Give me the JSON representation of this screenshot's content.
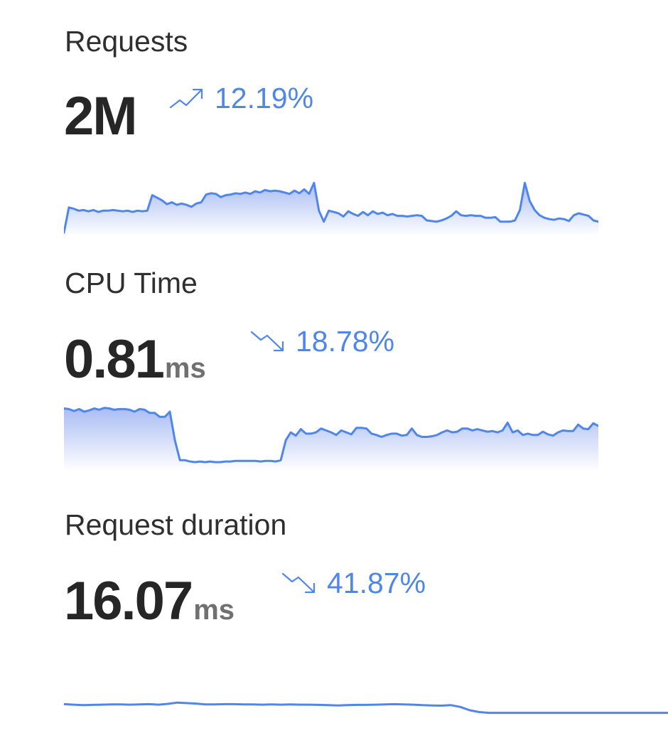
{
  "colors": {
    "accent": "#4f86ea",
    "fill_top": "#a9bcf3",
    "fill_bottom": "#ffffff",
    "title": "#2f2f2f",
    "value": "#262626",
    "unit": "#707070"
  },
  "metrics": [
    {
      "title": "Requests",
      "value": "2M",
      "unit": "",
      "change": "12.19%",
      "trend_icon": "trend-up-icon",
      "trend": "up",
      "sparkline": {
        "fill": true,
        "ylim": [
          0,
          100
        ],
        "values": [
          3,
          42,
          40,
          37,
          38,
          36,
          38,
          35,
          37,
          37,
          38,
          37,
          36,
          37,
          35,
          37,
          36,
          37,
          61,
          57,
          53,
          47,
          50,
          46,
          48,
          46,
          43,
          48,
          50,
          62,
          64,
          63,
          58,
          61,
          62,
          64,
          63,
          65,
          63,
          67,
          65,
          69,
          67,
          68,
          67,
          65,
          63,
          68,
          64,
          70,
          63,
          80,
          37,
          20,
          37,
          35,
          33,
          28,
          36,
          32,
          29,
          35,
          30,
          36,
          32,
          34,
          30,
          32,
          29,
          29,
          28,
          29,
          30,
          29,
          22,
          21,
          20,
          22,
          25,
          29,
          36,
          30,
          29,
          30,
          29,
          29,
          26,
          26,
          27,
          20,
          20,
          20,
          22,
          38,
          80,
          52,
          38,
          30,
          26,
          24,
          23,
          25,
          24,
          21,
          30,
          33,
          31,
          29,
          22,
          20
        ]
      }
    },
    {
      "title": "CPU Time",
      "value": "0.81",
      "unit": "ms",
      "change": "18.78%",
      "trend_icon": "trend-down-icon",
      "trend": "down",
      "sparkline": {
        "fill": true,
        "ylim": [
          0,
          100
        ],
        "values": [
          94,
          93,
          90,
          93,
          89,
          91,
          94,
          92,
          95,
          94,
          92,
          93,
          93,
          92,
          89,
          93,
          92,
          87,
          87,
          81,
          81,
          89,
          45,
          14,
          14,
          12,
          11,
          12,
          11,
          12,
          11,
          11,
          12,
          12,
          13,
          13,
          13,
          13,
          13,
          12,
          13,
          13,
          12,
          14,
          45,
          57,
          52,
          62,
          55,
          55,
          57,
          63,
          60,
          57,
          53,
          60,
          57,
          54,
          64,
          64,
          63,
          55,
          53,
          50,
          53,
          55,
          55,
          52,
          53,
          63,
          53,
          50,
          50,
          51,
          53,
          57,
          60,
          57,
          58,
          63,
          63,
          60,
          62,
          60,
          58,
          59,
          57,
          60,
          72,
          57,
          60,
          53,
          55,
          53,
          53,
          58,
          54,
          52,
          57,
          60,
          59,
          59,
          69,
          63,
          62,
          71,
          67
        ]
      }
    },
    {
      "title": "Request duration",
      "value": "16.07",
      "unit": "ms",
      "change": "41.87%",
      "trend_icon": "trend-down-icon",
      "trend": "down",
      "sparkline": {
        "fill": false,
        "ylim": [
          0,
          100
        ],
        "values": [
          49,
          47,
          45,
          46,
          47,
          48,
          48,
          47,
          48,
          49,
          47,
          50,
          55,
          53,
          51,
          48,
          48,
          49,
          49,
          48,
          48,
          47,
          48,
          47,
          48,
          47,
          47,
          46,
          45,
          44,
          45,
          46,
          46,
          47,
          48,
          49,
          48,
          47,
          45,
          44,
          43,
          45,
          38,
          25,
          18,
          15,
          15,
          15,
          15,
          15,
          15,
          15,
          15,
          15,
          15,
          15,
          15,
          15,
          15,
          15,
          15,
          15,
          15,
          15,
          15
        ]
      }
    }
  ]
}
